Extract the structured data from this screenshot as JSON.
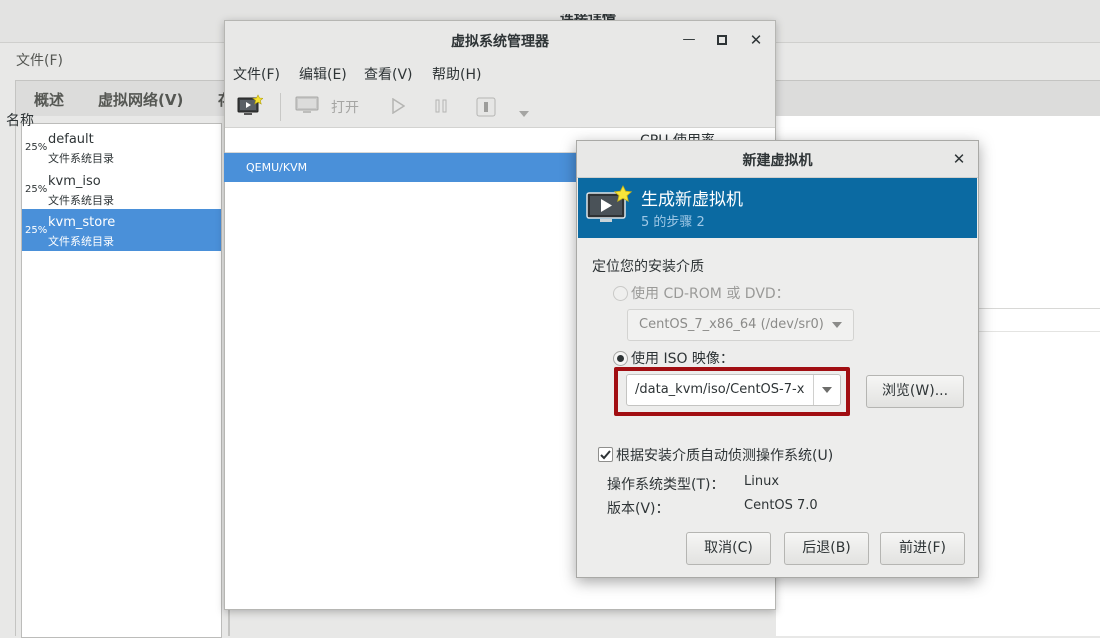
{
  "background_window": {
    "title": "连接详情",
    "menu_file": "文件(F)",
    "tabs": [
      "概述",
      "虚拟网络(V)",
      "存"
    ]
  },
  "storage_pools": [
    {
      "percent": "25%",
      "name": "default",
      "type": "文件系统目录",
      "selected": false
    },
    {
      "percent": "25%",
      "name": "kvm_iso",
      "type": "文件系统目录",
      "selected": false
    },
    {
      "percent": "25%",
      "name": "kvm_store",
      "type": "文件系统目录",
      "selected": true
    }
  ],
  "manager": {
    "title": "虚拟系统管理器",
    "menu": [
      "文件(F)",
      "编辑(E)",
      "查看(V)",
      "帮助(H)"
    ],
    "toolbar": {
      "open_label": "打开"
    },
    "columns": {
      "name": "名称",
      "cpu": "CPU 使用率"
    },
    "connection": "QEMU/KVM"
  },
  "dialog": {
    "title": "新建虚拟机",
    "banner_title": "生成新虚拟机",
    "banner_step": "5 的步骤 2",
    "section_label": "定位您的安装介质",
    "cdrom_option": "使用 CD-ROM 或 DVD：",
    "cdrom_device": "CentOS_7_x86_64 (/dev/sr0)",
    "iso_option": "使用 ISO 映像：",
    "iso_path": "/data_kvm/iso/CentOS-7-x",
    "browse_button": "浏览(W)...",
    "autodetect_label": "根据安装介质自动侦测操作系统(U)",
    "os_type_label": "操作系统类型(T)：",
    "os_type_value": "Linux",
    "version_label": "版本(V)：",
    "version_value": "CentOS 7.0",
    "cancel_button": "取消(C)",
    "back_button": "后退(B)",
    "forward_button": "前进(F)"
  },
  "colors": {
    "selection": "#4a90d9",
    "banner": "#0b6aa2",
    "highlight_border": "#a10e12"
  }
}
